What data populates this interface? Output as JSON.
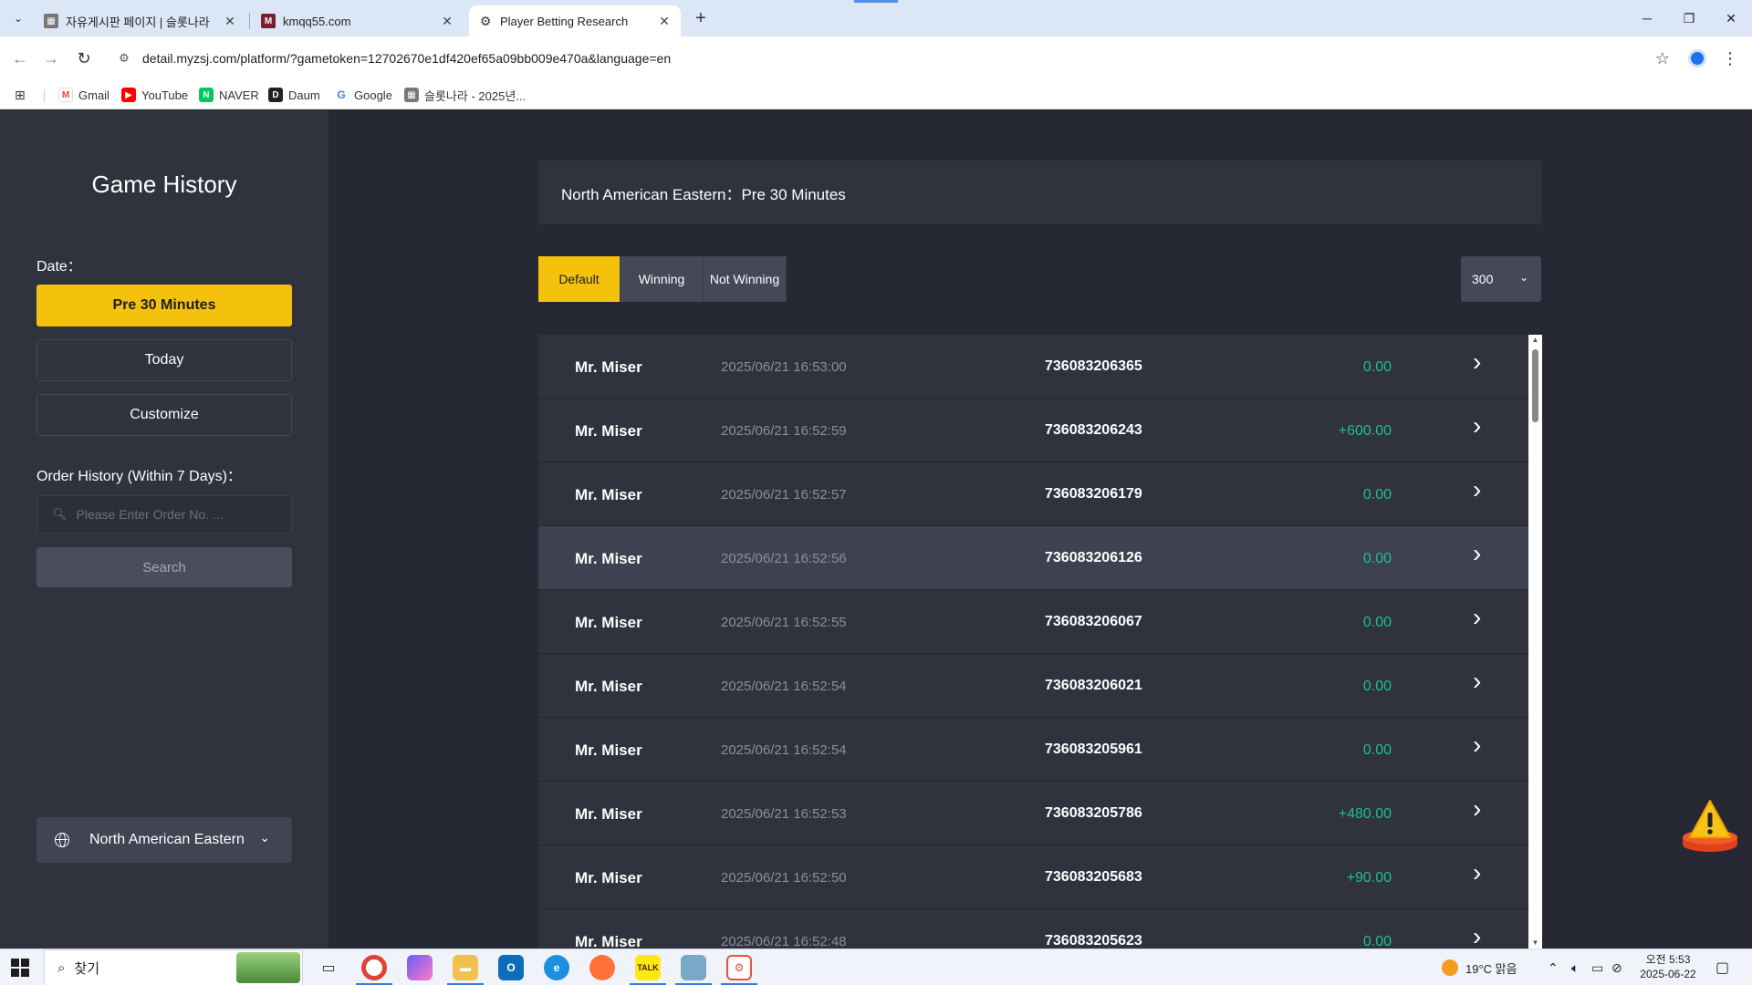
{
  "browser": {
    "tabs": [
      {
        "title": "자유게시판 페이지 | 슬롯나라",
        "active": false
      },
      {
        "title": "kmqq55.com",
        "active": false
      },
      {
        "title": "Player Betting Research",
        "active": true
      }
    ],
    "url": "detail.myzsj.com/platform/?gametoken=12702670e1df420ef65a09bb009e470a&language=en",
    "bookmarks": [
      "Gmail",
      "YouTube",
      "NAVER",
      "Daum",
      "Google",
      "슬롯나라 - 2025년..."
    ]
  },
  "sidebar": {
    "title": "Game History",
    "date_label": "Date：",
    "date_options": [
      "Pre 30 Minutes",
      "Today",
      "Customize"
    ],
    "order_label": "Order History (Within 7 Days)：",
    "order_placeholder": "Please Enter Order No. ...",
    "search_label": "Search",
    "timezone": "North American Eastern"
  },
  "main": {
    "header": "North American Eastern：Pre 30 Minutes",
    "filters": [
      "Default",
      "Winning",
      "Not Winning"
    ],
    "active_filter": "Default",
    "page_size": "300",
    "rows": [
      {
        "name": "Mr. Miser",
        "time": "2025/06/21 16:53:00",
        "order": "736083206365",
        "amount": "0.00"
      },
      {
        "name": "Mr. Miser",
        "time": "2025/06/21 16:52:59",
        "order": "736083206243",
        "amount": "+600.00"
      },
      {
        "name": "Mr. Miser",
        "time": "2025/06/21 16:52:57",
        "order": "736083206179",
        "amount": "0.00"
      },
      {
        "name": "Mr. Miser",
        "time": "2025/06/21 16:52:56",
        "order": "736083206126",
        "amount": "0.00"
      },
      {
        "name": "Mr. Miser",
        "time": "2025/06/21 16:52:55",
        "order": "736083206067",
        "amount": "0.00"
      },
      {
        "name": "Mr. Miser",
        "time": "2025/06/21 16:52:54",
        "order": "736083206021",
        "amount": "0.00"
      },
      {
        "name": "Mr. Miser",
        "time": "2025/06/21 16:52:54",
        "order": "736083205961",
        "amount": "0.00"
      },
      {
        "name": "Mr. Miser",
        "time": "2025/06/21 16:52:53",
        "order": "736083205786",
        "amount": "+480.00"
      },
      {
        "name": "Mr. Miser",
        "time": "2025/06/21 16:52:50",
        "order": "736083205683",
        "amount": "+90.00"
      },
      {
        "name": "Mr. Miser",
        "time": "2025/06/21 16:52:48",
        "order": "736083205623",
        "amount": "0.00"
      }
    ]
  },
  "taskbar": {
    "search_text": "찾기",
    "weather": "19°C 맑음",
    "time": "오전 5:53",
    "date": "2025-06-22"
  },
  "colors": {
    "accent": "#f4c20d",
    "win_green": "#1fbf8f",
    "page_bg": "#262833",
    "panel_bg": "#30323e"
  }
}
